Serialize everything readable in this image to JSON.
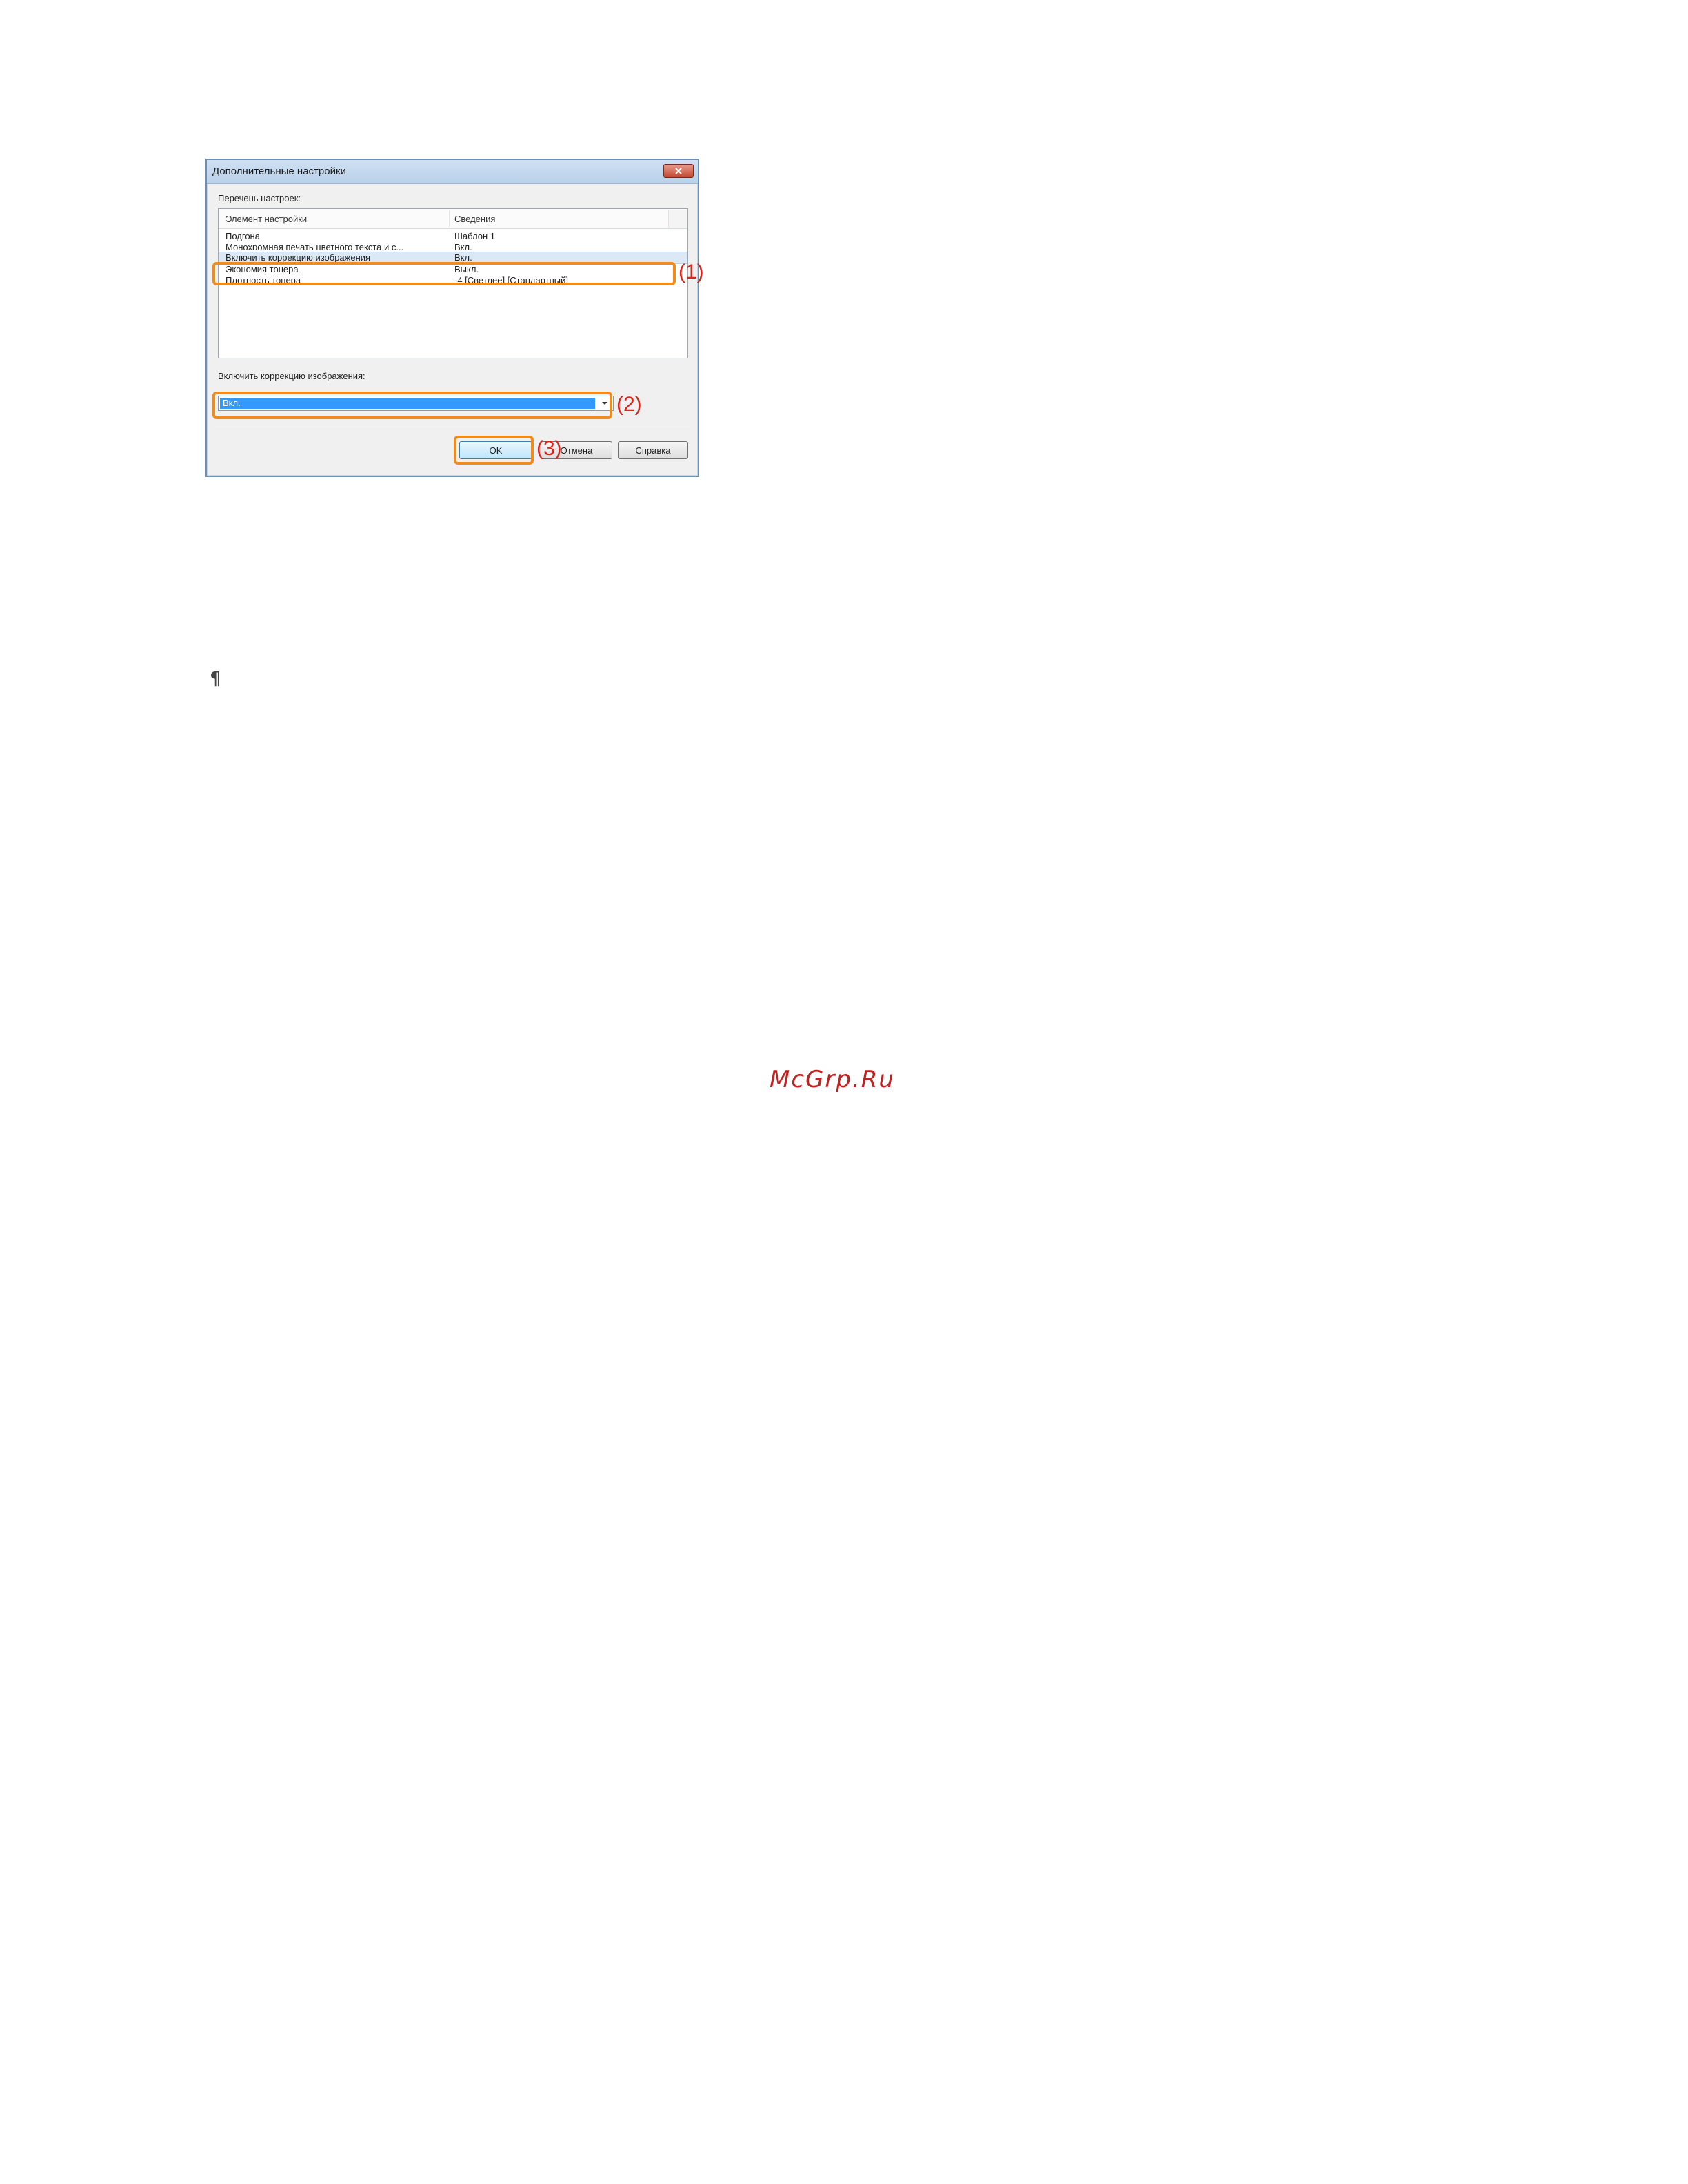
{
  "dialog": {
    "title": "Дополнительные настройки",
    "list_label": "Перечень настроек:",
    "columns": [
      "Элемент настройки",
      "Сведения"
    ],
    "rows": [
      {
        "name": "Подгона",
        "value": "Шаблон 1"
      },
      {
        "name": "Монохромная печать цветного текста и с...",
        "value": "Вкл."
      },
      {
        "name": "Включить коррекцию изображения",
        "value": "Вкл.",
        "selected": true
      },
      {
        "name": "Экономия тонера",
        "value": "Выкл."
      },
      {
        "name": "Плотность тонера",
        "value": "-4 [Светлее] [Стандартный]"
      }
    ],
    "field_label": "Включить коррекцию изображения:",
    "combo_value": "Вкл.",
    "buttons": {
      "ok": "OK",
      "cancel": "Отмена",
      "help": "Справка"
    }
  },
  "callouts": [
    "(1)",
    "(2)",
    "(3)"
  ],
  "pilcrow": "¶",
  "watermark": "McGrp.Ru",
  "colors": {
    "highlight": "#f08c1e",
    "callout_text": "#d9231b",
    "selection": "#3399ff",
    "watermark": "#c0231f"
  },
  "icons": {
    "close": "close-icon",
    "dropdown": "chevron-down-icon"
  }
}
